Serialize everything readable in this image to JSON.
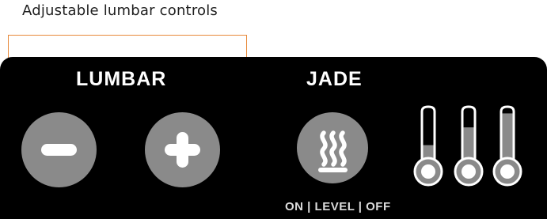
{
  "caption": "Adjustable lumbar controls",
  "lumbar": {
    "label": "LUMBAR",
    "minus_icon": "minus-icon",
    "plus_icon": "plus-icon"
  },
  "jade": {
    "label": "JADE",
    "heat_icon": "heat-waves-icon",
    "sub_label": "ON | LEVEL | OFF",
    "levels": [
      {
        "name": "level-1",
        "fill": 0.33
      },
      {
        "name": "level-2",
        "fill": 0.66
      },
      {
        "name": "level-3",
        "fill": 0.92
      }
    ]
  },
  "colors": {
    "panel": "#000000",
    "button": "#8a8a8a",
    "accent": "#e8893a",
    "text": "#ffffff"
  }
}
